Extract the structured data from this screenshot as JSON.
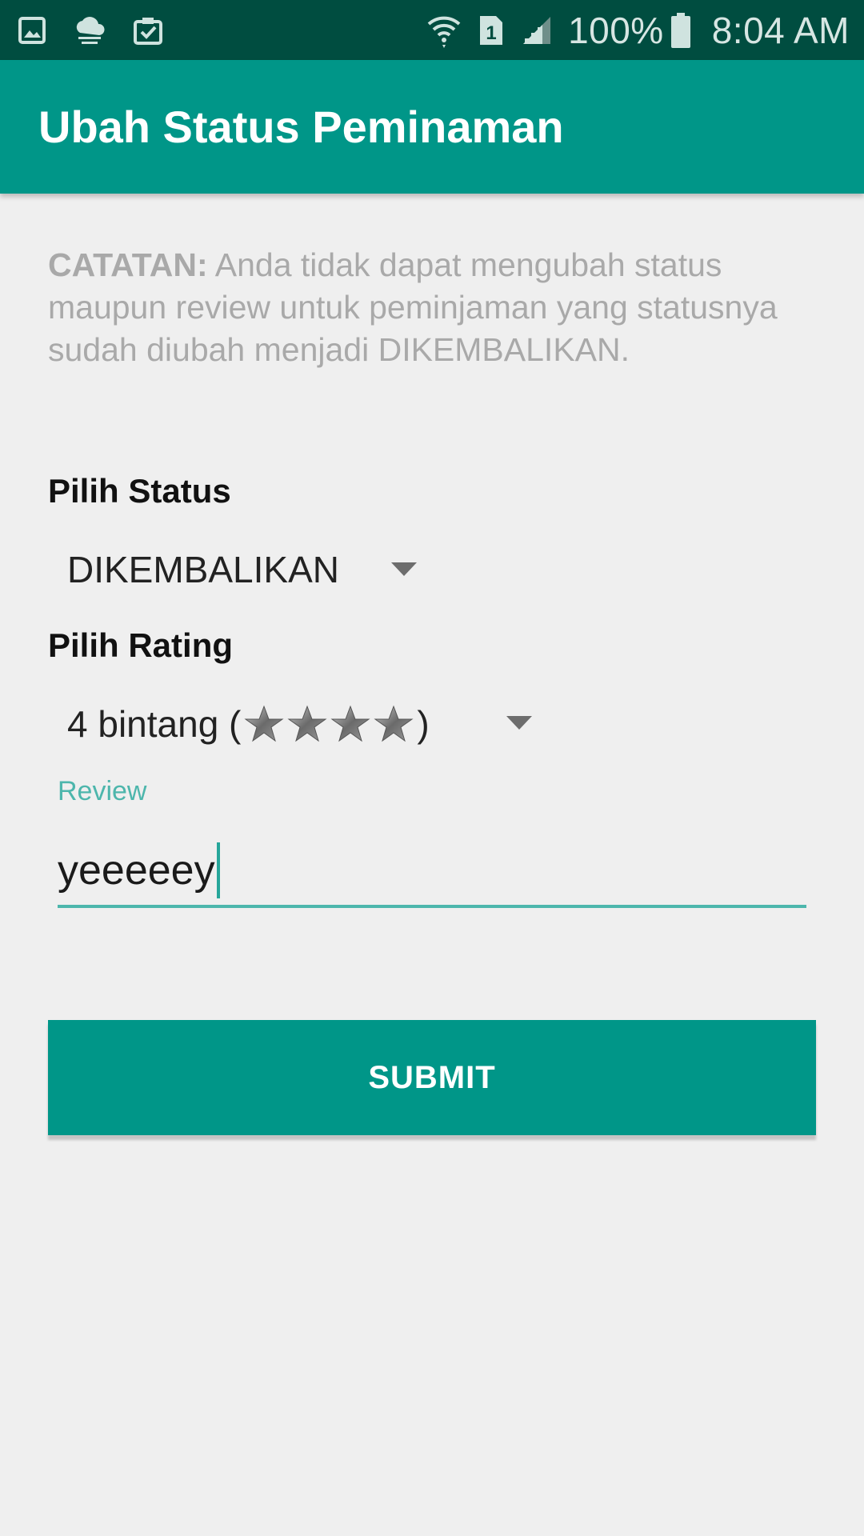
{
  "status_bar": {
    "battery": "100%",
    "time": "8:04 AM",
    "sim_slot": "1",
    "left_icons": [
      "gallery-icon",
      "cloud-icon",
      "clipboard-check-icon"
    ],
    "right_icons": [
      "wifi-icon",
      "sim-icon",
      "signal-icon",
      "battery-icon"
    ]
  },
  "app_bar": {
    "title": "Ubah Status Peminaman"
  },
  "note": {
    "prefix": "CATATAN:",
    "text": " Anda tidak dapat mengubah status maupun review untuk peminjaman yang statusnya sudah diubah menjadi DIKEMBALIKAN."
  },
  "status_section": {
    "label": "Pilih Status",
    "selected": "DIKEMBALIKAN"
  },
  "rating_section": {
    "label": "Pilih Rating",
    "selected_prefix": "4 bintang (",
    "selected_suffix": ")",
    "stars": 4
  },
  "review": {
    "label": "Review",
    "value": "yeeeeey"
  },
  "submit": {
    "label": "SUBMIT"
  },
  "colors": {
    "primary": "#009688",
    "primary_dark": "#004d40",
    "accent": "#4db6ac",
    "background": "#efefef"
  }
}
